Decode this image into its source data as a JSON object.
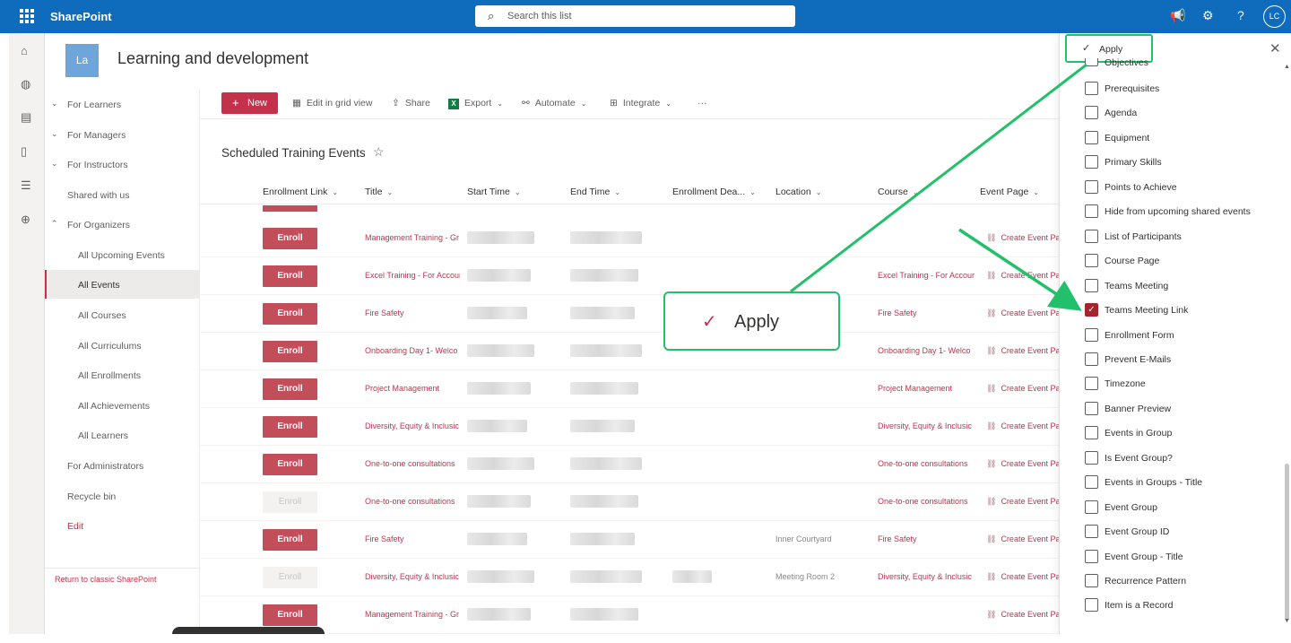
{
  "topbar": {
    "brand": "SharePoint",
    "search_placeholder": "Search this list",
    "avatar_initials": "LC",
    "icons": [
      "waffle-icon",
      "megaphone-icon",
      "gear-icon",
      "help-icon"
    ]
  },
  "site": {
    "logo_text": "La",
    "title": "Learning and development"
  },
  "leftnav": {
    "items": [
      {
        "label": "For Learners",
        "chevron": "down"
      },
      {
        "label": "For Managers",
        "chevron": "down"
      },
      {
        "label": "For Instructors",
        "chevron": "down"
      },
      {
        "label": "Shared with us",
        "chevron": ""
      },
      {
        "label": "For Organizers",
        "chevron": "up"
      },
      {
        "label": "All Upcoming Events",
        "chevron": ""
      },
      {
        "label": "All Events",
        "chevron": ""
      },
      {
        "label": "All Courses",
        "chevron": ""
      },
      {
        "label": "All Curriculums",
        "chevron": ""
      },
      {
        "label": "All Enrollments",
        "chevron": ""
      },
      {
        "label": "All Achievements",
        "chevron": ""
      },
      {
        "label": "All Learners",
        "chevron": ""
      },
      {
        "label": "For Administrators",
        "chevron": ""
      },
      {
        "label": "Recycle bin",
        "chevron": ""
      },
      {
        "label": "Edit",
        "chevron": ""
      }
    ],
    "classic_link": "Return to classic SharePoint"
  },
  "commandbar": {
    "new_label": "New",
    "grid_label": "Edit in grid view",
    "share_label": "Share",
    "export_label": "Export",
    "automate_label": "Automate",
    "integrate_label": "Integrate",
    "more_label": "···"
  },
  "list": {
    "title": "Scheduled Training Events",
    "columns": [
      "Enrollment Link",
      "Title",
      "Start Time",
      "End Time",
      "Enrollment Dea...",
      "Location",
      "Course",
      "Event Page"
    ],
    "enroll_label": "Enroll",
    "event_page_label": "Create Event Page",
    "rows": [
      {
        "title": "Management Training - Gr",
        "location": "",
        "course": "",
        "enabled": true
      },
      {
        "title": "Excel Training - For Accour",
        "location": "",
        "course": "Excel Training - For Accour",
        "enabled": true
      },
      {
        "title": "Fire Safety",
        "location": "",
        "course": "Fire Safety",
        "enabled": true
      },
      {
        "title": "Onboarding Day 1- Welco",
        "location": "",
        "course": "Onboarding Day 1- Welco",
        "enabled": true
      },
      {
        "title": "Project Management",
        "location": "",
        "course": "Project Management",
        "enabled": true
      },
      {
        "title": "Diversity, Equity & Inclusic",
        "location": "",
        "course": "Diversity, Equity & Inclusic",
        "enabled": true
      },
      {
        "title": "One-to-one consultations",
        "location": "",
        "course": "One-to-one consultations",
        "enabled": true
      },
      {
        "title": "One-to-one consultations",
        "location": "",
        "course": "One-to-one consultations",
        "enabled": false
      },
      {
        "title": "Fire Safety",
        "location": "Inner Courtyard",
        "course": "Fire Safety",
        "enabled": true
      },
      {
        "title": "Diversity, Equity & Inclusic",
        "location": "Meeting Room 2",
        "course": "Diversity, Equity & Inclusic",
        "enabled": false
      },
      {
        "title": "Management Training - Gr",
        "location": "",
        "course": "",
        "enabled": true
      }
    ]
  },
  "panel": {
    "apply_label": "Apply",
    "partial_label": "Objectives",
    "columns": [
      {
        "label": "Prerequisites",
        "checked": false
      },
      {
        "label": "Agenda",
        "checked": false
      },
      {
        "label": "Equipment",
        "checked": false
      },
      {
        "label": "Primary Skills",
        "checked": false
      },
      {
        "label": "Points to Achieve",
        "checked": false
      },
      {
        "label": "Hide from upcoming shared events",
        "checked": false
      },
      {
        "label": "List of Participants",
        "checked": false
      },
      {
        "label": "Course Page",
        "checked": false
      },
      {
        "label": "Teams Meeting",
        "checked": false
      },
      {
        "label": "Teams Meeting Link",
        "checked": true
      },
      {
        "label": "Enrollment Form",
        "checked": false
      },
      {
        "label": "Prevent E-Mails",
        "checked": false
      },
      {
        "label": "Timezone",
        "checked": false
      },
      {
        "label": "Banner Preview",
        "checked": false
      },
      {
        "label": "Events in Group",
        "checked": false
      },
      {
        "label": "Is Event Group?",
        "checked": false
      },
      {
        "label": "Events in Groups - Title",
        "checked": false
      },
      {
        "label": "Event Group",
        "checked": false
      },
      {
        "label": "Event Group ID",
        "checked": false
      },
      {
        "label": "Event Group - Title",
        "checked": false
      },
      {
        "label": "Recurrence Pattern",
        "checked": false
      },
      {
        "label": "Item is a Record",
        "checked": false
      }
    ]
  },
  "callout": {
    "label": "Apply"
  },
  "colors": {
    "brand": "#0f6cbd",
    "accent": "#c4314b",
    "highlight": "#22c06a"
  }
}
